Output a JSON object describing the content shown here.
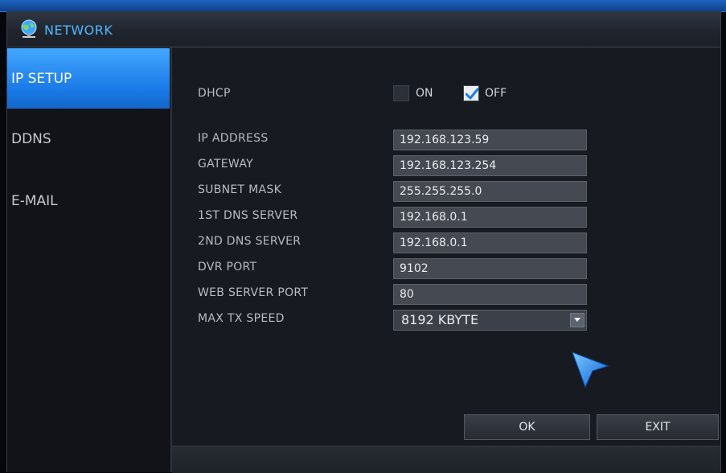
{
  "window": {
    "title": "NETWORK",
    "icon": "network-globe-icon"
  },
  "sidebar": {
    "items": [
      {
        "label": "IP SETUP",
        "active": true
      },
      {
        "label": "DDNS",
        "active": false
      },
      {
        "label": "E-MAIL",
        "active": false
      }
    ]
  },
  "dhcp": {
    "label": "DHCP",
    "on_label": "ON",
    "off_label": "OFF",
    "on_checked": false,
    "off_checked": true
  },
  "fields": [
    {
      "label": "IP ADDRESS",
      "value": "192.168.123.59"
    },
    {
      "label": "GATEWAY",
      "value": "192.168.123.254"
    },
    {
      "label": "SUBNET MASK",
      "value": "255.255.255.0"
    },
    {
      "label": "1ST DNS SERVER",
      "value": "192.168.0.1"
    },
    {
      "label": "2ND DNS SERVER",
      "value": "192.168.0.1"
    },
    {
      "label": "DVR PORT",
      "value": "9102"
    },
    {
      "label": "WEB SERVER PORT",
      "value": "80"
    }
  ],
  "max_tx": {
    "label": "MAX TX SPEED",
    "value": "8192 KBYTE"
  },
  "buttons": {
    "ok": "OK",
    "exit": "EXIT"
  },
  "colors": {
    "accent": "#1979e6",
    "title_text": "#52b8ff",
    "checkmark": "#1a7fe8"
  }
}
